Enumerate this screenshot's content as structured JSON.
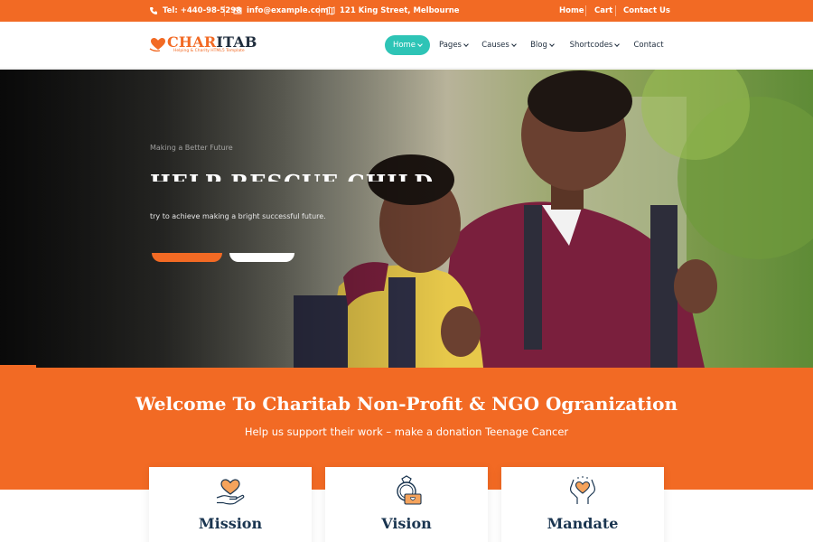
{
  "topbar": {
    "phone": "Tel: +440-98-5298",
    "email": "info@example.com",
    "address": "121 King Street, Melbourne",
    "links": [
      "Home",
      "Cart",
      "Contact Us"
    ]
  },
  "logo": {
    "brand_part1": "CHAR",
    "brand_part2": "ITAB",
    "tagline": "Helping & Charity HTML5 Template"
  },
  "nav": {
    "items": [
      {
        "label": "Home",
        "dropdown": true,
        "active": true
      },
      {
        "label": "Pages",
        "dropdown": true,
        "active": false
      },
      {
        "label": "Causes",
        "dropdown": true,
        "active": false
      },
      {
        "label": "Blog",
        "dropdown": true,
        "active": false
      },
      {
        "label": "Shortcodes",
        "dropdown": true,
        "active": false
      },
      {
        "label": "Contact",
        "dropdown": false,
        "active": false
      }
    ]
  },
  "hero": {
    "subtitle": "Making a Better Future",
    "title": "HELP RESCUE CHILD",
    "text": "try to achieve making a bright successful future."
  },
  "welcome": {
    "title": "Welcome To Charitab Non-Profit & NGO Ogranization",
    "subtitle": "Help us support their work – make a donation Teenage Cancer"
  },
  "cards": [
    {
      "title": "Mission",
      "icon": "heart-hand-icon"
    },
    {
      "title": "Vision",
      "icon": "ring-money-icon"
    },
    {
      "title": "Mandate",
      "icon": "hands-heart-icon"
    }
  ],
  "colors": {
    "accent": "#f26a24",
    "teal": "#2ec4b6",
    "navy": "#1a3550"
  }
}
